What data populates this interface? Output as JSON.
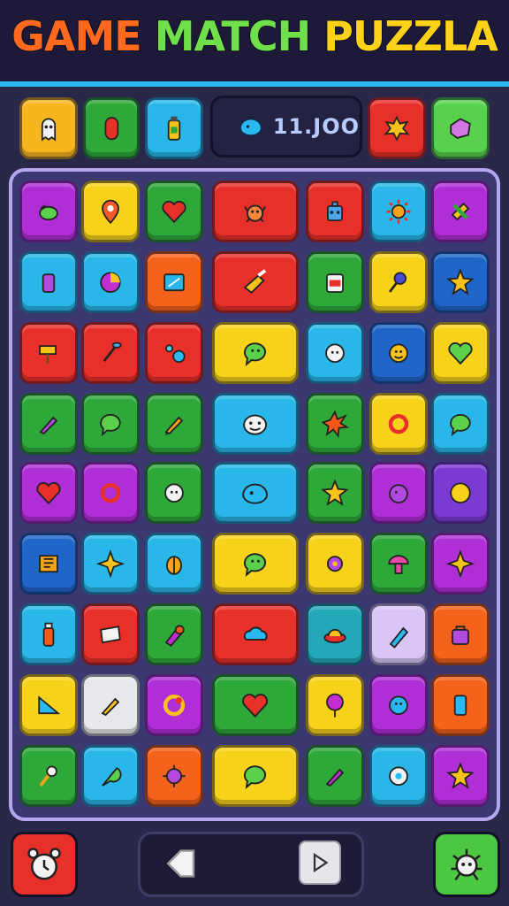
{
  "header": {
    "title_words": [
      "GAME",
      "MATCH",
      "PUZZLA"
    ]
  },
  "toolbar": {
    "score_value": "11.JOO",
    "score_icon": "blue-blob-icon",
    "left_items": [
      {
        "name": "ghost-booster",
        "icon": "ghost-icon",
        "color": "#f7b61e"
      },
      {
        "name": "capsule-booster",
        "icon": "capsule-icon",
        "color": "#2fa83a"
      },
      {
        "name": "bottle-booster",
        "icon": "bottle-icon",
        "color": "#28b7e8"
      }
    ],
    "right_items": [
      {
        "name": "splat-booster",
        "icon": "splat-icon",
        "color": "#e8302a"
      },
      {
        "name": "gem-booster",
        "icon": "gem-icon",
        "color": "#58d24c"
      }
    ]
  },
  "board": {
    "rows": 9,
    "columns": 7
  },
  "footer": {
    "left_button_icon": "alarm-clock-icon",
    "right_button_icon": "bug-icon",
    "prev_icon": "arrow-left-icon",
    "next_icon": "play-icon"
  }
}
